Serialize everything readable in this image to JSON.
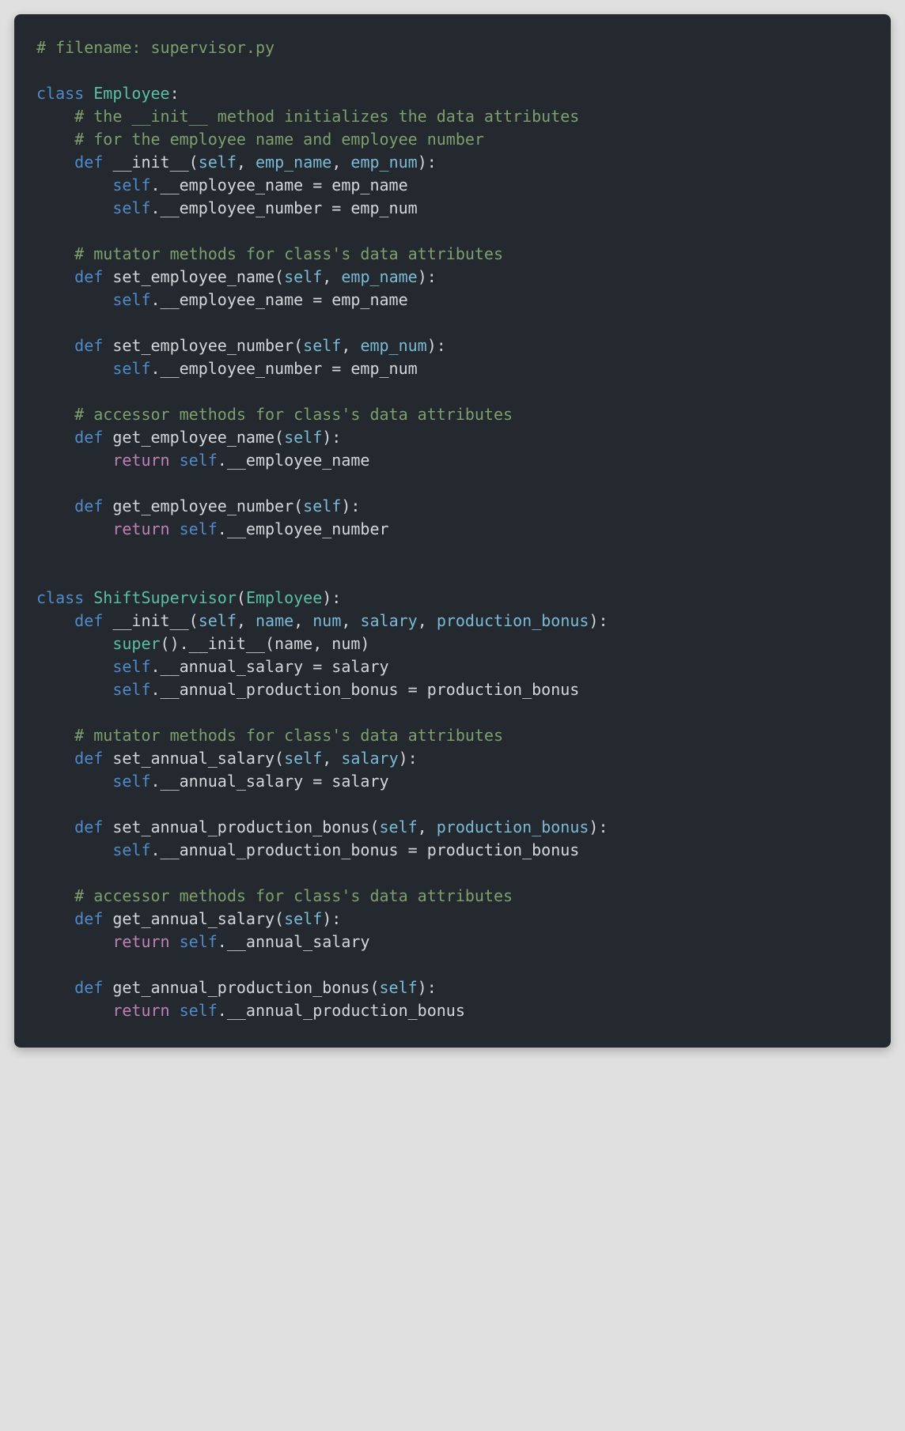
{
  "colors": {
    "background_page": "#e0e0e0",
    "background_code": "#242930",
    "text_default": "#d4d7da",
    "comment": "#7f9e6d",
    "keyword": "#4f8ac9",
    "classname": "#5bbfa3",
    "param": "#7bbad4",
    "return_kw": "#c07fb6"
  },
  "code": {
    "l01": "# filename: supervisor.py",
    "l02": "",
    "c_class": "class",
    "c_Employee": "Employee",
    "l04_cmt": "# the __init__ method initializes the data attributes",
    "l05_cmt": "# for the employee name and employee number",
    "kw_def": "def",
    "fn_init": "__init__",
    "p_self": "self",
    "p_emp_name": "emp_name",
    "p_emp_num": "emp_num",
    "attr_emp_name": ".__employee_name = emp_name",
    "attr_emp_num": ".__employee_number = emp_num",
    "cmt_mutator": "# mutator methods for class's data attributes",
    "fn_set_emp_name": "set_employee_name",
    "fn_set_emp_num": "set_employee_number",
    "cmt_accessor": "# accessor methods for class's data attributes",
    "fn_get_emp_name": "get_employee_name",
    "fn_get_emp_num": "get_employee_number",
    "kw_return": "return",
    "ret_emp_name": ".__employee_name",
    "ret_emp_num": ".__employee_number",
    "c_ShiftSupervisor": "ShiftSupervisor",
    "p_name": "name",
    "p_num": "num",
    "p_salary": "salary",
    "p_prod_bonus": "production_bonus",
    "fn_super": "super",
    "super_call": "().__init__(name, num)",
    "attr_salary": ".__annual_salary = salary",
    "attr_bonus": ".__annual_production_bonus = production_bonus",
    "fn_set_salary": "set_annual_salary",
    "fn_set_bonus": "set_annual_production_bonus",
    "fn_get_salary": "get_annual_salary",
    "fn_get_bonus": "get_annual_production_bonus",
    "ret_salary": ".__annual_salary",
    "ret_bonus": ".__annual_production_bonus"
  }
}
